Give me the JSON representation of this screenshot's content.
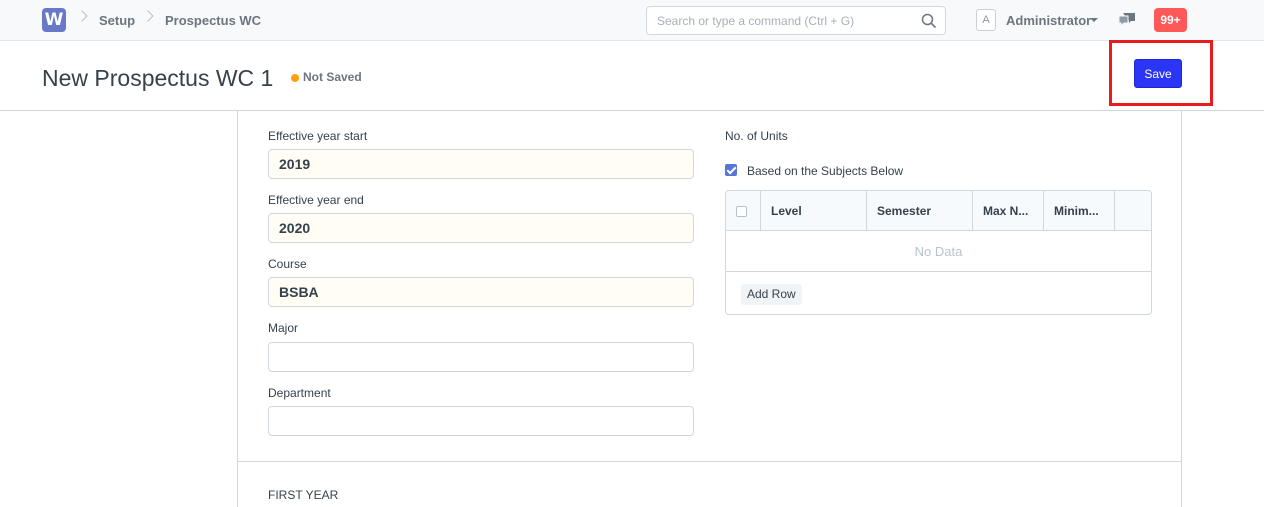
{
  "navbar": {
    "logo_letter": "W",
    "breadcrumbs": [
      "Setup",
      "Prospectus WC"
    ],
    "search_placeholder": "Search or type a command (Ctrl + G)",
    "avatar_letter": "A",
    "user_name": "Administrator",
    "notification_count": "99+"
  },
  "header": {
    "title": "New Prospectus WC 1",
    "status": "Not Saved",
    "save_label": "Save"
  },
  "form": {
    "fields": [
      {
        "label": "Effective year start",
        "value": "2019"
      },
      {
        "label": "Effective year end",
        "value": "2020"
      },
      {
        "label": "Course",
        "value": "BSBA"
      },
      {
        "label": "Major",
        "value": ""
      },
      {
        "label": "Department",
        "value": ""
      }
    ],
    "units_label": "No. of Units",
    "checkbox_label": "Based on the Subjects Below",
    "grid": {
      "columns": [
        "Level",
        "Semester",
        "Max N...",
        "Minim..."
      ],
      "empty_text": "No Data",
      "add_row_label": "Add Row"
    },
    "section_heading": "FIRST YEAR"
  },
  "colors": {
    "primary": "#2b35f5",
    "badge": "#ff5858",
    "status_dot": "#ffa00a",
    "annotation": "#e81c1c"
  }
}
